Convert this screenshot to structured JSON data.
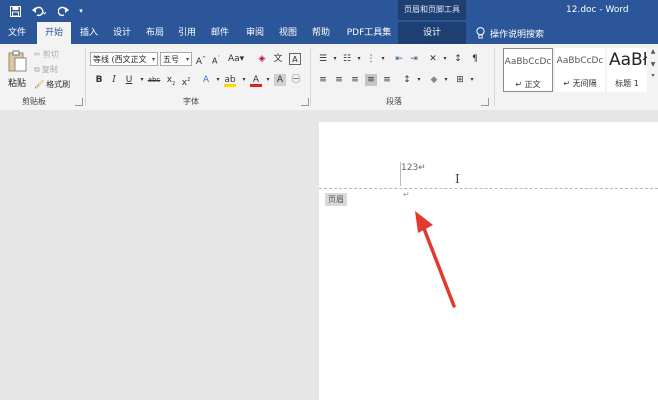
{
  "titlebar": {
    "contextual_title": "页眉和页脚工具",
    "document_title": "12.doc - Word",
    "colors": {
      "brand": "#2b579a",
      "contextual": "#1e3f72"
    }
  },
  "tabs": [
    {
      "label": "文件"
    },
    {
      "label": "开始"
    },
    {
      "label": "插入"
    },
    {
      "label": "设计"
    },
    {
      "label": "布局"
    },
    {
      "label": "引用"
    },
    {
      "label": "邮件"
    },
    {
      "label": "审阅"
    },
    {
      "label": "视图"
    },
    {
      "label": "帮助"
    },
    {
      "label": "PDF工具集"
    },
    {
      "label": "设计"
    }
  ],
  "tell_me": "操作说明搜索",
  "ribbon": {
    "clipboard": {
      "paste": "粘贴",
      "cut": "剪切",
      "copy": "复制",
      "format_painter": "格式刷",
      "label": "剪贴板"
    },
    "font": {
      "font_name": "等线 (西文正文",
      "font_size": "五号",
      "label": "字体"
    },
    "paragraph": {
      "label": "段落"
    },
    "styles": [
      {
        "sample": "AaBbCcDc",
        "name": "↵ 正文"
      },
      {
        "sample": "AaBbCcDc",
        "name": "↵ 无间隔"
      },
      {
        "sample": "AaBł",
        "name": "标题 1"
      }
    ]
  },
  "document": {
    "header_tag": "页眉",
    "header_text": "123↵",
    "return_mark": "↵"
  }
}
